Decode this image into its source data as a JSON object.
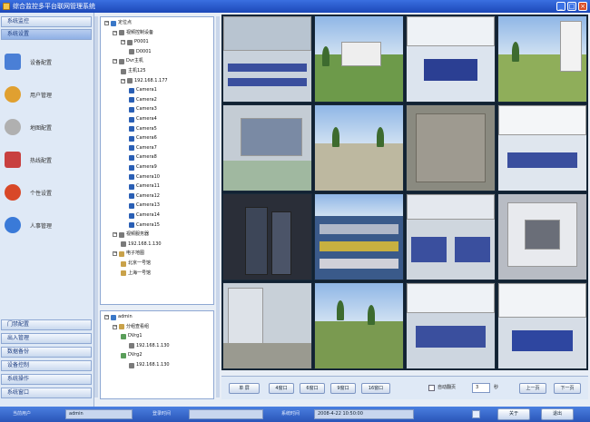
{
  "window": {
    "title": "综合监控多平台联网管理系统"
  },
  "left_nav_top": [
    {
      "label": "系统监控"
    },
    {
      "label": "系统设置"
    }
  ],
  "left_items": [
    {
      "label": "设备配置",
      "icon": "monitor-icon",
      "color": "#4a7fd6"
    },
    {
      "label": "用户管理",
      "icon": "users-icon",
      "color": "#e0a030"
    },
    {
      "label": "地图配置",
      "icon": "map-icon",
      "color": "#b0b0b0"
    },
    {
      "label": "热线配置",
      "icon": "house-icon",
      "color": "#c84040"
    },
    {
      "label": "个性设置",
      "icon": "target-icon",
      "color": "#d84828"
    },
    {
      "label": "人事管理",
      "icon": "person-icon",
      "color": "#3a7ad8"
    }
  ],
  "left_nav_bottom": [
    {
      "label": "门禁配置"
    },
    {
      "label": "出入管理"
    },
    {
      "label": "数据备份"
    },
    {
      "label": "设备控制"
    },
    {
      "label": "系统操作"
    },
    {
      "label": "系统窗口"
    }
  ],
  "tree_top": [
    {
      "label": "定位点",
      "level": 0,
      "icon": "root"
    },
    {
      "label": "视频控制设备",
      "level": 1,
      "icon": "dev"
    },
    {
      "label": "P0001",
      "level": 2,
      "icon": "dev"
    },
    {
      "label": "D0001",
      "level": 3,
      "icon": "dev"
    },
    {
      "label": "Dvr主机",
      "level": 1,
      "icon": "dev"
    },
    {
      "label": "主机125",
      "level": 2,
      "icon": "dev"
    },
    {
      "label": "192.168.1.177",
      "level": 2,
      "icon": "dev"
    },
    {
      "label": "Camera1",
      "level": 3,
      "icon": "cam"
    },
    {
      "label": "Camera2",
      "level": 3,
      "icon": "cam"
    },
    {
      "label": "Camera3",
      "level": 3,
      "icon": "cam"
    },
    {
      "label": "Camera4",
      "level": 3,
      "icon": "cam"
    },
    {
      "label": "Camera5",
      "level": 3,
      "icon": "cam"
    },
    {
      "label": "Camera6",
      "level": 3,
      "icon": "cam"
    },
    {
      "label": "Camera7",
      "level": 3,
      "icon": "cam"
    },
    {
      "label": "Camera8",
      "level": 3,
      "icon": "cam"
    },
    {
      "label": "Camera9",
      "level": 3,
      "icon": "cam"
    },
    {
      "label": "Camera10",
      "level": 3,
      "icon": "cam"
    },
    {
      "label": "Camera11",
      "level": 3,
      "icon": "cam"
    },
    {
      "label": "Camera12",
      "level": 3,
      "icon": "cam"
    },
    {
      "label": "Camera13",
      "level": 3,
      "icon": "cam"
    },
    {
      "label": "Camera14",
      "level": 3,
      "icon": "cam"
    },
    {
      "label": "Camera15",
      "level": 3,
      "icon": "cam"
    },
    {
      "label": "视频服务器",
      "level": 1,
      "icon": "dev"
    },
    {
      "label": "192.168.1.130",
      "level": 2,
      "icon": "dev"
    },
    {
      "label": "电子地图",
      "level": 1,
      "icon": "grp"
    },
    {
      "label": "北京一号馆",
      "level": 2,
      "icon": "grp"
    },
    {
      "label": "上海一号馆",
      "level": 2,
      "icon": "grp"
    }
  ],
  "tree_bottom": [
    {
      "label": "admin",
      "level": 0,
      "icon": "root"
    },
    {
      "label": "分组查看组",
      "level": 1,
      "icon": "grp"
    },
    {
      "label": "DVrg1",
      "level": 2,
      "icon": "rec"
    },
    {
      "label": "192.168.1.130",
      "level": 3,
      "icon": "dev"
    },
    {
      "label": "DVrg2",
      "level": 2,
      "icon": "rec"
    },
    {
      "label": "192.168.1.130",
      "level": 3,
      "icon": "dev"
    }
  ],
  "controls": {
    "buttons": [
      {
        "label": "单 屏"
      },
      {
        "label": "4窗口"
      },
      {
        "label": "6窗口"
      },
      {
        "label": "9窗口"
      },
      {
        "label": "16窗口"
      }
    ],
    "checkbox_label": "自动翻页",
    "interval_value": "3",
    "interval_unit": "秒",
    "prev_label": "上一页",
    "next_label": "下一页"
  },
  "status": {
    "user_label": "当前用户",
    "user_value": "admin",
    "login_label": "登录时间",
    "login_value": "",
    "time_label": "系统时间",
    "time_value": "2008-4-22 10:50:00",
    "help_label": "关于",
    "exit_label": "退出"
  }
}
